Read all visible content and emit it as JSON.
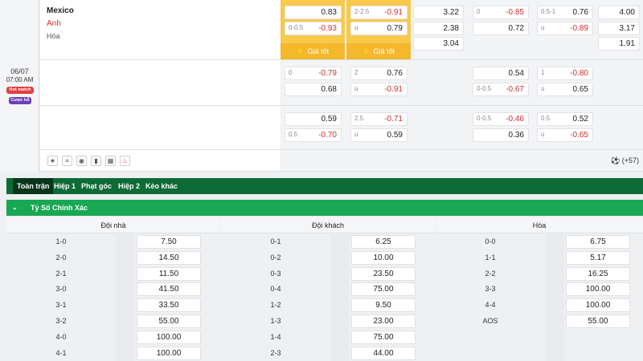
{
  "match": {
    "date": "06/07",
    "time": "07:00 AM",
    "badges": [
      "Hot match",
      "Cược hỗ"
    ],
    "home": "Mexico",
    "away": "Anh",
    "draw": "Hòa",
    "extra_count": "(+57)"
  },
  "odds_rows": [
    {
      "ft_hdp": {
        "home_label": "",
        "home": "0.83",
        "away_label": "0-0.5",
        "away": "-0.93"
      },
      "ft_ou": {
        "over_label": "2-2.5",
        "over": "-0.91",
        "under_label": "u",
        "under": "0.79"
      },
      "ft_1x2": [
        "3.22",
        "2.38",
        "3.04"
      ],
      "h1_hdp": {
        "home_label": "0",
        "home": "-0.85",
        "away_label": "",
        "away": "0.72"
      },
      "h1_ou": {
        "over_label": "0.5-1",
        "over": "0.76",
        "under_label": "u",
        "under": "-0.89"
      },
      "h1_1x2": [
        "4.00",
        "3.17",
        "1.91"
      ]
    },
    {
      "ft_hdp": {
        "home_label": "0",
        "home": "-0.79",
        "away_label": "",
        "away": "0.68"
      },
      "ft_ou": {
        "over_label": "2",
        "over": "0.76",
        "under_label": "u",
        "under": "-0.91"
      },
      "h1_hdp": {
        "home_label": "",
        "home": "0.54",
        "away_label": "0-0.5",
        "away": "-0.67"
      },
      "h1_ou": {
        "over_label": "1",
        "over": "-0.80",
        "under_label": "u",
        "under": "0.65"
      }
    },
    {
      "ft_hdp": {
        "home_label": "",
        "home": "0.59",
        "away_label": "0.5",
        "away": "-0.70"
      },
      "ft_ou": {
        "over_label": "2.5",
        "over": "-0.71",
        "under_label": "u",
        "under": "0.59"
      },
      "h1_hdp": {
        "home_label": "0-0.5",
        "home": "-0.46",
        "away_label": "",
        "away": "0.36"
      },
      "h1_ou": {
        "over_label": "0.5",
        "over": "0.52",
        "under_label": "u",
        "under": "-0.65"
      }
    }
  ],
  "best_price_label": "Giá tốt",
  "tabs": [
    "Toàn trận",
    "Hiệp 1",
    "Phạt góc",
    "Hiệp 2",
    "Kèo khác"
  ],
  "section_title": "Tỷ Số Chính Xác",
  "columns": {
    "home": {
      "title": "Đội nhà",
      "rows": [
        [
          "1-0",
          "7.50"
        ],
        [
          "2-0",
          "14.50"
        ],
        [
          "2-1",
          "11.50"
        ],
        [
          "3-0",
          "41.50"
        ],
        [
          "3-1",
          "33.50"
        ],
        [
          "3-2",
          "55.00"
        ],
        [
          "4-0",
          "100.00"
        ],
        [
          "4-1",
          "100.00"
        ]
      ]
    },
    "away": {
      "title": "Đội khách",
      "rows": [
        [
          "0-1",
          "6.25"
        ],
        [
          "0-2",
          "10.00"
        ],
        [
          "0-3",
          "23.50"
        ],
        [
          "0-4",
          "75.00"
        ],
        [
          "1-2",
          "9.50"
        ],
        [
          "1-3",
          "23.00"
        ],
        [
          "1-4",
          "75.00"
        ],
        [
          "2-3",
          "44.00"
        ]
      ]
    },
    "draw": {
      "title": "Hòa",
      "rows": [
        [
          "0-0",
          "6.75"
        ],
        [
          "1-1",
          "5.17"
        ],
        [
          "2-2",
          "16.25"
        ],
        [
          "3-3",
          "100.00"
        ],
        [
          "4-4",
          "100.00"
        ],
        [
          "AOS",
          "55.00"
        ]
      ]
    }
  },
  "colors": {
    "negative": "#d32f2f",
    "tab_bar": "#0c6b36",
    "section_green": "#18a853",
    "gold": "#f3b82b"
  }
}
